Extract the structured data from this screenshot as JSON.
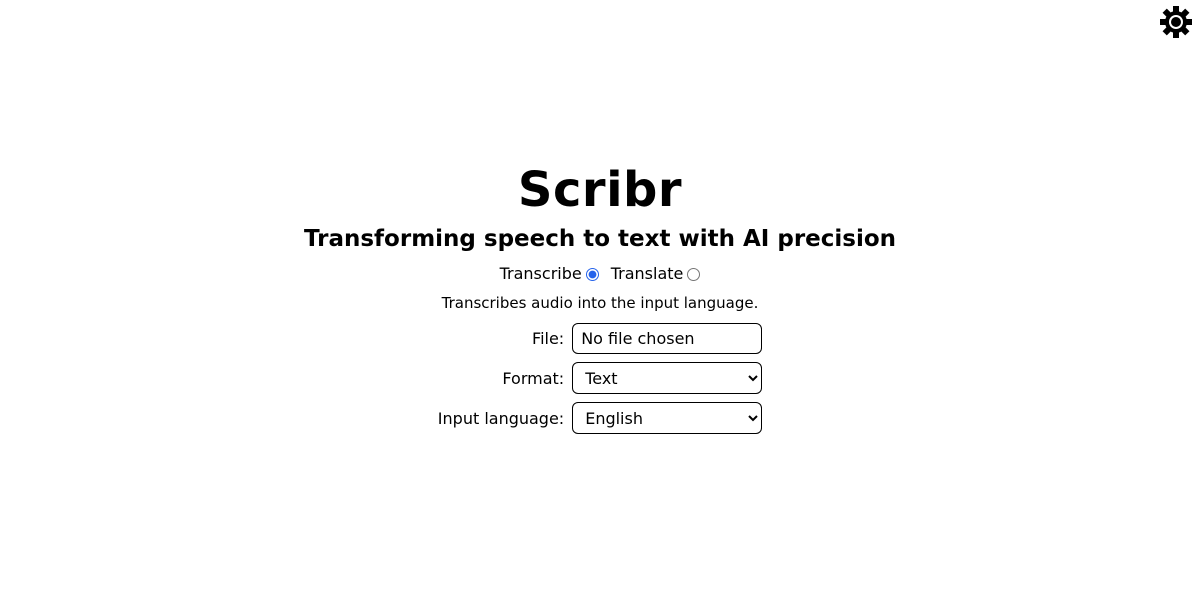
{
  "header": {
    "settings_icon": "gear-icon"
  },
  "app": {
    "title": "Scribr",
    "subtitle": "Transforming speech to text with AI precision"
  },
  "mode": {
    "options": [
      {
        "label": "Transcribe",
        "selected": true
      },
      {
        "label": "Translate",
        "selected": false
      }
    ],
    "description": "Transcribes audio into the input language."
  },
  "form": {
    "file": {
      "label": "File:",
      "value": "No file chosen"
    },
    "format": {
      "label": "Format:",
      "value": "Text"
    },
    "input_language": {
      "label": "Input language:",
      "value": "English"
    }
  },
  "colors": {
    "radio_accent": "#2563eb"
  }
}
